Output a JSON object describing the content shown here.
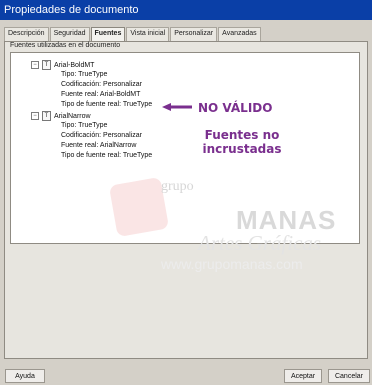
{
  "window": {
    "title": "Propiedades de documento"
  },
  "tabs": [
    {
      "label": "Descripción"
    },
    {
      "label": "Seguridad"
    },
    {
      "label": "Fuentes"
    },
    {
      "label": "Vista inicial"
    },
    {
      "label": "Personalizar"
    },
    {
      "label": "Avanzadas"
    }
  ],
  "fonts_group": {
    "label": "Fuentes utilizadas en el documento"
  },
  "fonts": [
    {
      "name": "Arial-BoldMT",
      "type": "Tipo: TrueType",
      "encoding": "Codificación: Personalizar",
      "actual": "Fuente real: Arial-BoldMT",
      "actual_type": "Tipo de fuente real: TrueType"
    },
    {
      "name": "ArialNarrow",
      "type": "Tipo: TrueType",
      "encoding": "Codificación: Personalizar",
      "actual": "Fuente real: ArialNarrow",
      "actual_type": "Tipo de fuente real: TrueType"
    }
  ],
  "annotations": {
    "invalid": "NO VÁLIDO",
    "not_embedded_1": "Fuentes no",
    "not_embedded_2": "incrustadas",
    "color": "#7a2f8e"
  },
  "watermark": {
    "line1": "grupo",
    "line2": "MANAS",
    "line3": "Artes Gráficas",
    "line4": "www.grupomanas.com"
  },
  "buttons": {
    "help": "Ayuda",
    "accept": "Aceptar",
    "cancel": "Cancelar"
  }
}
